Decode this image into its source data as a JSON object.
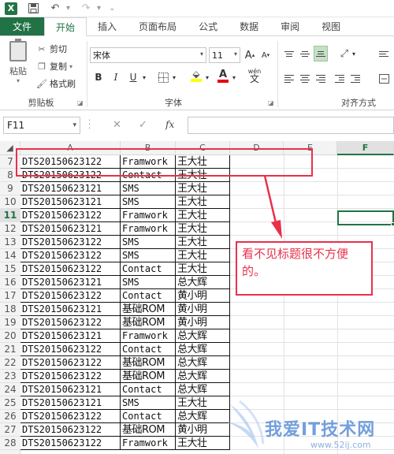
{
  "quick_access": {
    "app_logo": "X",
    "icons": [
      "save-icon",
      "undo-icon",
      "redo-icon",
      "customize-icon"
    ],
    "undo_glyph": "↶",
    "redo_glyph": "↷",
    "more_glyph": "⌄"
  },
  "ribbon_tabs": [
    "文件",
    "开始",
    "插入",
    "页面布局",
    "公式",
    "数据",
    "审阅",
    "视图"
  ],
  "ribbon": {
    "paste_label": "粘贴",
    "clipboard": {
      "cut": "剪切",
      "copy": "复制",
      "format_painter": "格式刷",
      "group_label": "剪贴板"
    },
    "font": {
      "name": "宋体",
      "size": "11",
      "group_label": "字体",
      "grow": "A",
      "shrink": "A",
      "bold": "B",
      "italic": "I",
      "underline": "U",
      "fill": "◣",
      "color": "A",
      "phonetic": "wén"
    },
    "alignment": {
      "group_label": "对齐方式"
    }
  },
  "formula_bar": {
    "name_box": "F11",
    "cancel": "✕",
    "enter": "✓",
    "fx": "fx",
    "value": ""
  },
  "sheet": {
    "columns": [
      "A",
      "B",
      "C",
      "D",
      "E",
      "F"
    ],
    "active_column": "F",
    "active_row": 11,
    "active_cell": "F11",
    "rows": [
      {
        "n": 7,
        "a": "DTS20150623122",
        "b": "Framwork",
        "c": "王大壮"
      },
      {
        "n": 8,
        "a": "DTS20150623122",
        "b": "Contact",
        "c": "王大壮"
      },
      {
        "n": 9,
        "a": "DTS20150623121",
        "b": "SMS",
        "c": "王大壮"
      },
      {
        "n": 10,
        "a": "DTS20150623121",
        "b": "SMS",
        "c": "王大壮"
      },
      {
        "n": 11,
        "a": "DTS20150623122",
        "b": "Framwork",
        "c": "王大壮"
      },
      {
        "n": 12,
        "a": "DTS20150623121",
        "b": "Framwork",
        "c": "王大壮"
      },
      {
        "n": 13,
        "a": "DTS20150623122",
        "b": "SMS",
        "c": "王大壮"
      },
      {
        "n": 14,
        "a": "DTS20150623122",
        "b": "SMS",
        "c": "王大壮"
      },
      {
        "n": 15,
        "a": "DTS20150623122",
        "b": "Contact",
        "c": "王大壮"
      },
      {
        "n": 16,
        "a": "DTS20150623121",
        "b": "SMS",
        "c": "总大辉"
      },
      {
        "n": 17,
        "a": "DTS20150623122",
        "b": "Contact",
        "c": "黄小明"
      },
      {
        "n": 18,
        "a": "DTS20150623121",
        "b": "基础ROM",
        "c": "黄小明"
      },
      {
        "n": 19,
        "a": "DTS20150623122",
        "b": "基础ROM",
        "c": "黄小明"
      },
      {
        "n": 20,
        "a": "DTS20150623121",
        "b": "Framwork",
        "c": "总大辉"
      },
      {
        "n": 21,
        "a": "DTS20150623122",
        "b": "Contact",
        "c": "总大辉"
      },
      {
        "n": 22,
        "a": "DTS20150623122",
        "b": "基础ROM",
        "c": "总大辉"
      },
      {
        "n": 23,
        "a": "DTS20150623122",
        "b": "基础ROM",
        "c": "总大辉"
      },
      {
        "n": 24,
        "a": "DTS20150623121",
        "b": "Contact",
        "c": "总大辉"
      },
      {
        "n": 25,
        "a": "DTS20150623121",
        "b": "SMS",
        "c": "王大壮"
      },
      {
        "n": 26,
        "a": "DTS20150623122",
        "b": "Contact",
        "c": "总大辉"
      },
      {
        "n": 27,
        "a": "DTS20150623122",
        "b": "基础ROM",
        "c": "黄小明"
      },
      {
        "n": 28,
        "a": "DTS20150623122",
        "b": "Framwork",
        "c": "王大壮"
      }
    ]
  },
  "annotation": {
    "note_text": "看不见标题很不方便的。",
    "color": "#e8314a"
  },
  "watermark": {
    "text": "我爱IT技术网",
    "url": "www.52ij.com"
  },
  "colors": {
    "excel_green": "#217346",
    "selected_button": "#c6e0c6"
  }
}
